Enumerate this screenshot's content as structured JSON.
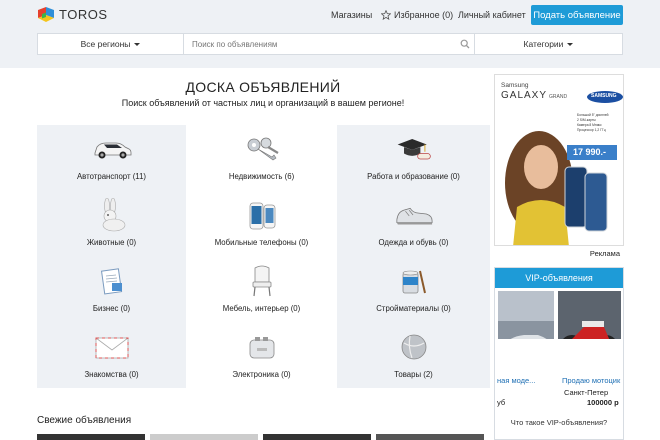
{
  "header": {
    "logo_text": "TOROS",
    "nav": {
      "shops": "Магазины",
      "favorites": "Избранное (0)",
      "cabinet": "Личный кабинет"
    },
    "post_button": "Подать объявление",
    "search": {
      "region": "Все регионы",
      "placeholder": "Поиск по объявлениям",
      "categories": "Категории"
    }
  },
  "main": {
    "title": "ДОСКА ОБЪЯВЛЕНИЙ",
    "subtitle": "Поиск объявлений от частных лиц и организаций в вашем регионе!",
    "categories": [
      {
        "label": "Автотранспорт (11)",
        "icon": "car-icon"
      },
      {
        "label": "Недвижимость (6)",
        "icon": "keys-icon"
      },
      {
        "label": "Работа и образование (0)",
        "icon": "graduation-cap-icon"
      },
      {
        "label": "Животные (0)",
        "icon": "rabbit-icon"
      },
      {
        "label": "Мобильные телефоны (0)",
        "icon": "phones-icon"
      },
      {
        "label": "Одежда и обувь (0)",
        "icon": "sneaker-icon"
      },
      {
        "label": "Бизнес (0)",
        "icon": "document-icon"
      },
      {
        "label": "Мебель, интерьер (0)",
        "icon": "chair-icon"
      },
      {
        "label": "Стройматериалы (0)",
        "icon": "paint-can-icon"
      },
      {
        "label": "Знакомства (0)",
        "icon": "envelope-icon"
      },
      {
        "label": "Электроника (0)",
        "icon": "toaster-icon"
      },
      {
        "label": "Товары (2)",
        "icon": "ball-icon"
      }
    ],
    "fresh_heading": "Свежие объявления"
  },
  "sidebar": {
    "ad": {
      "brand_small": "Samsung",
      "model": "GALAXY",
      "model_suffix": "GRAND",
      "logo": "SAMSUNG",
      "price": "17 990.-",
      "bullets": [
        "Большой 5\" дисплей",
        "2 SIM-карты",
        "Камера 8 Мпикс",
        "Процессор 1,2 ГГц"
      ],
      "label": "Реклама"
    },
    "vip": {
      "heading": "VIP-объявления",
      "items": [
        {
          "title": "ная моде...",
          "city": "",
          "price": "уб"
        },
        {
          "title": "Продаю мотоцик",
          "city": "Санкт-Петер",
          "price": "100000 р"
        }
      ],
      "what_link": "Что такое VIP-объявления?"
    }
  },
  "colors": {
    "accent": "#1e9bd7",
    "header_bg": "#eef1f5",
    "tile_grey": "#eef1f5"
  }
}
